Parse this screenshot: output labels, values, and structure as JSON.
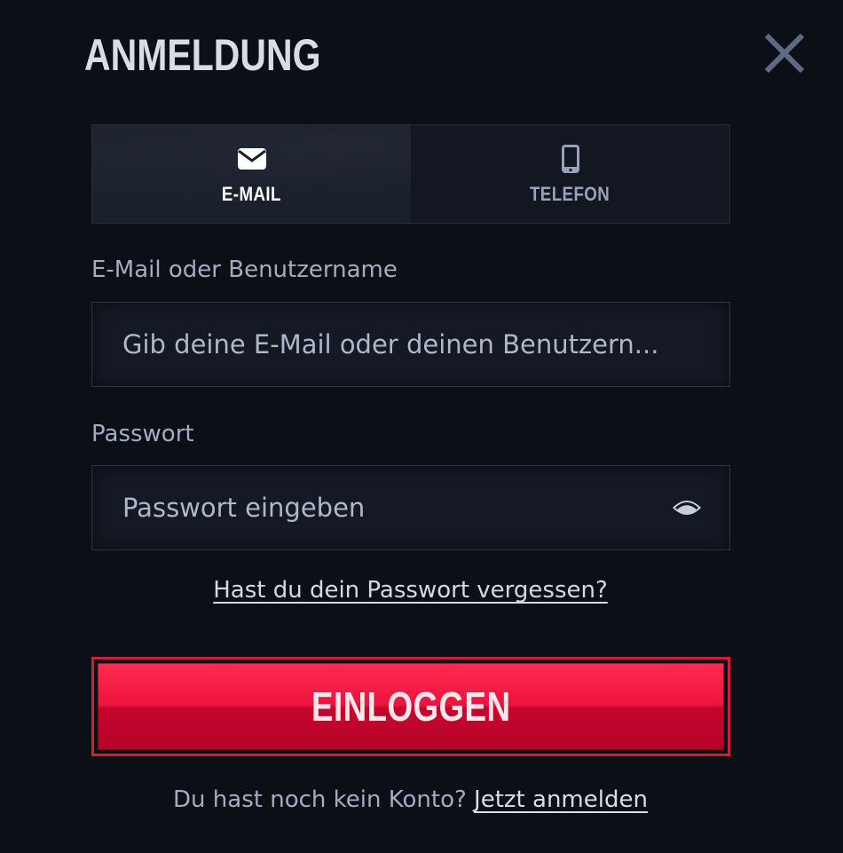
{
  "modal": {
    "title": "ANMELDUNG"
  },
  "tabs": [
    {
      "label": "E-MAIL",
      "icon": "envelope-icon",
      "active": true
    },
    {
      "label": "TELEFON",
      "icon": "phone-icon",
      "active": false
    }
  ],
  "email_field": {
    "label": "E-Mail oder Benutzername",
    "placeholder": "Gib deine E-Mail oder deinen Benutzern...",
    "value": ""
  },
  "password_field": {
    "label": "Passwort",
    "placeholder": "Passwort eingeben",
    "value": "",
    "toggle_icon": "eye-icon"
  },
  "forgot_password": "Hast du dein Passwort vergessen?",
  "login_button": "EINLOGGEN",
  "signup": {
    "prompt": "Du hast noch kein Konto?",
    "link": "Jetzt anmelden"
  },
  "colors": {
    "background": "#0c0f16",
    "accent": "#e8113c",
    "text": "#a3adc1"
  }
}
